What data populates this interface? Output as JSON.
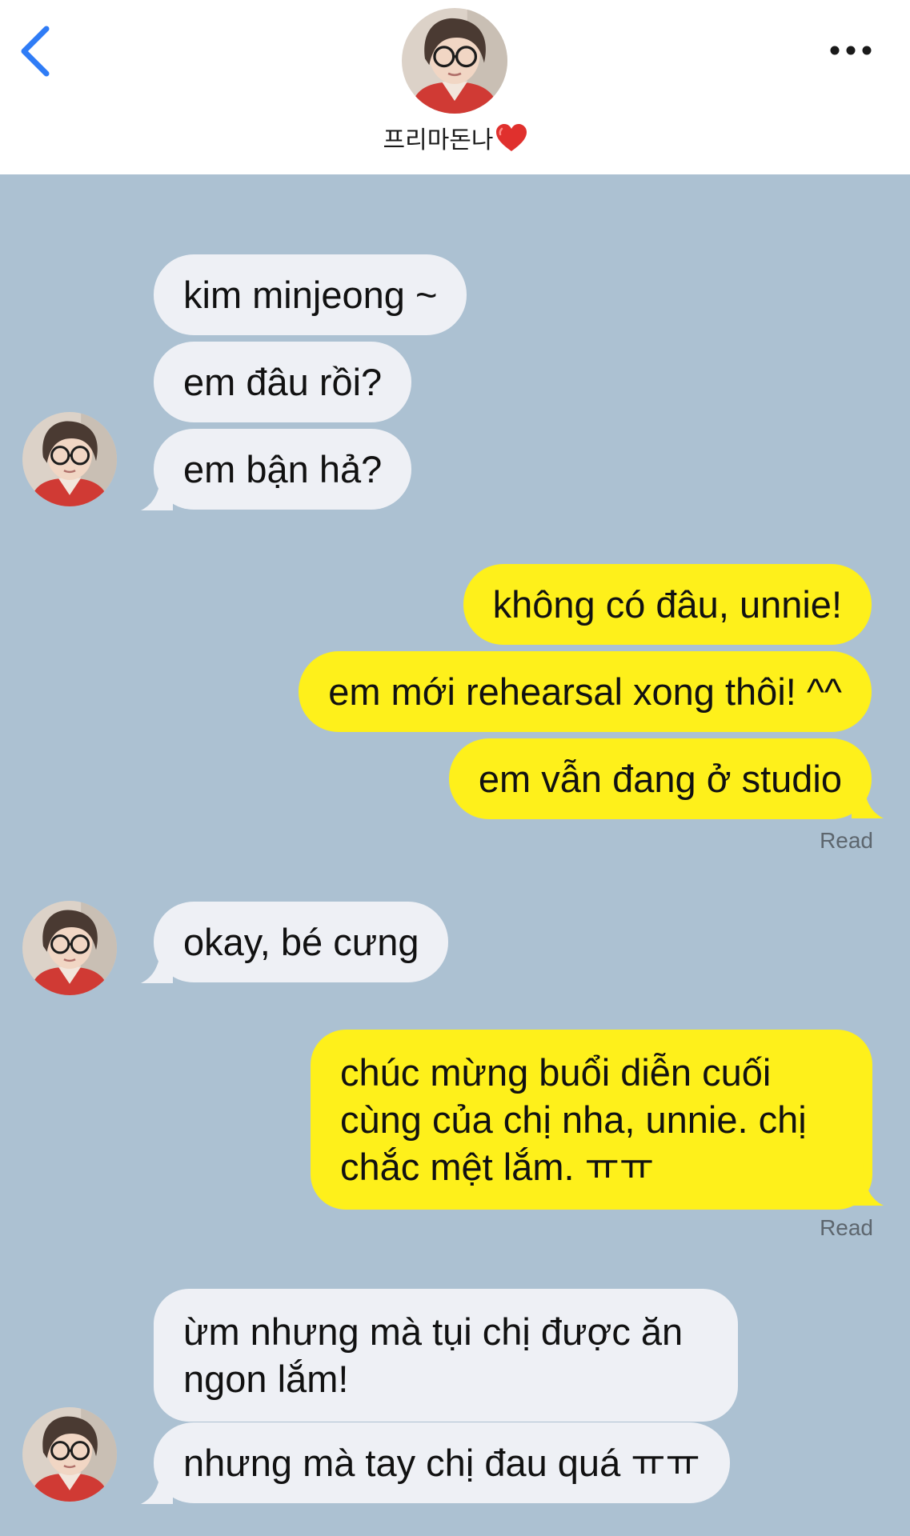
{
  "header": {
    "contact_name": "프리마돈나",
    "heart": "❤️",
    "back_icon": "chevron-left-icon",
    "more_icon": "more-horizontal-icon"
  },
  "messages": [
    {
      "sender": "contact",
      "text": "kim minjeong ~"
    },
    {
      "sender": "contact",
      "text": "em đâu rồi?"
    },
    {
      "sender": "contact",
      "text": "em bận hả?"
    },
    {
      "sender": "me",
      "text": "không có đâu, unnie!"
    },
    {
      "sender": "me",
      "text": "em mới rehearsal xong thôi! ^^"
    },
    {
      "sender": "me",
      "text": "em vẫn đang ở studio"
    },
    {
      "sender": "contact",
      "text": "okay, bé cưng"
    },
    {
      "sender": "me",
      "text": "chúc mừng buổi diễn cuối cùng của chị nha, unnie. chị chắc mệt lắm. ㅠㅠ"
    },
    {
      "sender": "contact",
      "text": "ừm nhưng mà tụi chị được ăn ngon lắm!"
    },
    {
      "sender": "contact",
      "text": "nhưng mà tay chị đau quá ㅠㅠ"
    }
  ],
  "read_receipts": [
    "Read",
    "Read"
  ],
  "colors": {
    "background": "#acc1d2",
    "incoming_bubble": "#eef0f5",
    "outgoing_bubble": "#fef01b",
    "accent": "#2f7cf6"
  }
}
